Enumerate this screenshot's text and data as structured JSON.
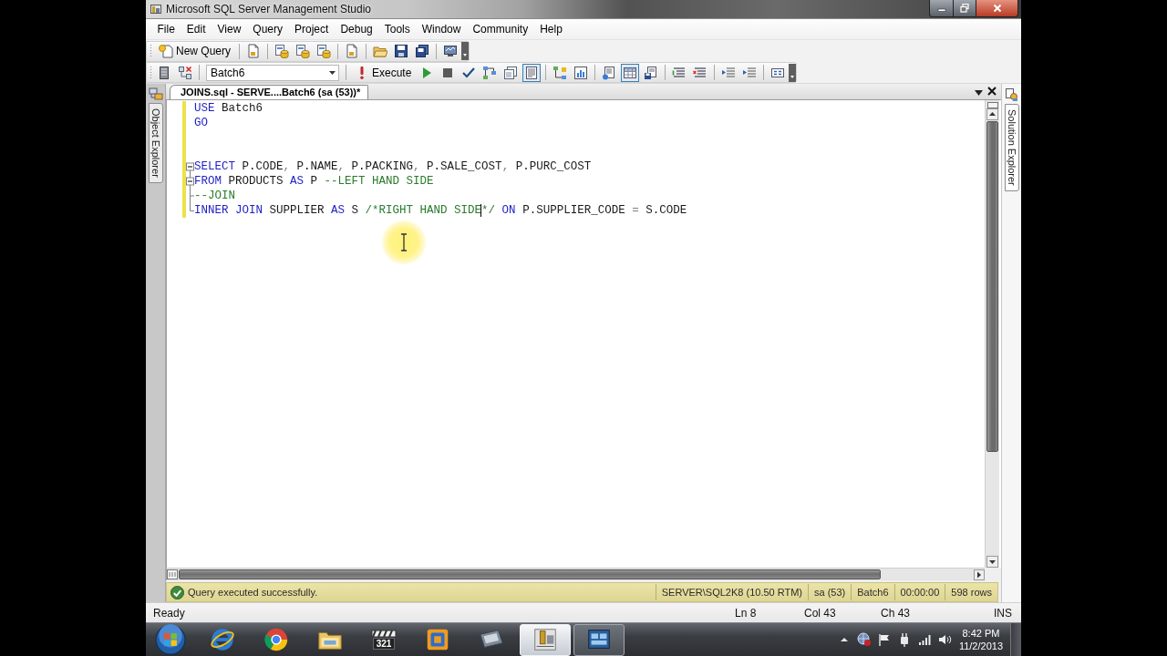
{
  "window": {
    "title": "Microsoft SQL Server Management Studio"
  },
  "menu": [
    "File",
    "Edit",
    "View",
    "Query",
    "Project",
    "Debug",
    "Tools",
    "Window",
    "Community",
    "Help"
  ],
  "standard_toolbar": {
    "new_query": "New Query"
  },
  "query_toolbar": {
    "database": "Batch6",
    "execute": "Execute",
    "toggles": [
      {
        "pressed": false
      },
      {
        "pressed": false
      },
      {
        "pressed": true
      },
      {
        "pressed": false
      },
      {
        "pressed": false
      },
      {
        "pressed": false
      },
      {
        "pressed": true
      },
      {
        "pressed": false
      }
    ]
  },
  "left_dock": {
    "label": "Object Explorer"
  },
  "right_dock": {
    "label": "Solution Explorer"
  },
  "document_tabs": [
    {
      "label": "JOINS.sql - SERVE....Batch6 (sa (53))*",
      "selected": true
    }
  ],
  "editor": {
    "lines": [
      {
        "kind": "plain",
        "changed": true,
        "tokens": [
          {
            "kind": "keyword",
            "text": "USE"
          },
          {
            "kind": "plain",
            "text": " Batch6"
          }
        ]
      },
      {
        "kind": "plain",
        "changed": true,
        "tokens": [
          {
            "kind": "keyword",
            "text": "GO"
          }
        ]
      },
      {
        "kind": "plain",
        "changed": true
      },
      {
        "kind": "plain",
        "changed": true
      },
      {
        "kind": "fold_start",
        "changed": true,
        "tokens": [
          {
            "kind": "keyword",
            "text": "SELECT"
          },
          {
            "kind": "plain",
            "text": " P.CODE"
          },
          {
            "kind": "operator",
            "text": ","
          },
          {
            "kind": "plain",
            "text": " P.NAME"
          },
          {
            "kind": "operator",
            "text": ","
          },
          {
            "kind": "plain",
            "text": " P.PACKING"
          },
          {
            "kind": "operator",
            "text": ","
          },
          {
            "kind": "plain",
            "text": " P.SALE_COST"
          },
          {
            "kind": "operator",
            "text": ","
          },
          {
            "kind": "plain",
            "text": " P.PURC_COST"
          }
        ]
      },
      {
        "kind": "fold_start",
        "changed": true,
        "tokens": [
          {
            "kind": "keyword",
            "text": "FROM"
          },
          {
            "kind": "plain",
            "text": " PRODUCTS "
          },
          {
            "kind": "keyword",
            "text": "AS"
          },
          {
            "kind": "plain",
            "text": " P "
          },
          {
            "kind": "comment",
            "text": "--LEFT HAND SIDE"
          }
        ]
      },
      {
        "kind": "fold_middle",
        "changed": true,
        "tokens": [
          {
            "kind": "comment",
            "text": "--JOIN"
          }
        ]
      },
      {
        "kind": "fold_end",
        "changed": true,
        "tokens": [
          {
            "kind": "keyword",
            "text": "INNER JOIN"
          },
          {
            "kind": "plain",
            "text": " SUPPLIER "
          },
          {
            "kind": "keyword",
            "text": "AS"
          },
          {
            "kind": "plain",
            "text": " S "
          },
          {
            "kind": "comment",
            "text": "/*RIGHT HAND SIDE"
          },
          {
            "kind": "comment",
            "text": "*/",
            "caret": true
          },
          {
            "kind": "keyword",
            "text": " ON"
          },
          {
            "kind": "plain",
            "text": " P.SUPPLIER_CODE "
          },
          {
            "kind": "operator",
            "text": "="
          },
          {
            "kind": "plain",
            "text": " S.CODE"
          }
        ]
      }
    ]
  },
  "query_status": {
    "message": "Query executed successfully.",
    "info": [
      "SERVER\\SQL2K8 (10.50 RTM)",
      "sa (53)",
      "Batch6",
      "00:00:00",
      "598 rows"
    ]
  },
  "status_bar": {
    "state": "Ready",
    "line": "Ln 8",
    "column": "Col 43",
    "character": "Ch 43",
    "mode": "INS"
  },
  "taskbar": {
    "apps": [
      {
        "running": false,
        "active": false
      },
      {
        "running": false,
        "active": false
      },
      {
        "running": false,
        "active": false
      },
      {
        "label": "321",
        "running": false,
        "active": false
      },
      {
        "running": false,
        "active": false
      },
      {
        "running": false,
        "active": false
      },
      {
        "running": true,
        "active": true
      },
      {
        "running": true,
        "active": false
      }
    ],
    "clock": {
      "time": "8:42 PM",
      "date": "11/2/2013"
    }
  }
}
